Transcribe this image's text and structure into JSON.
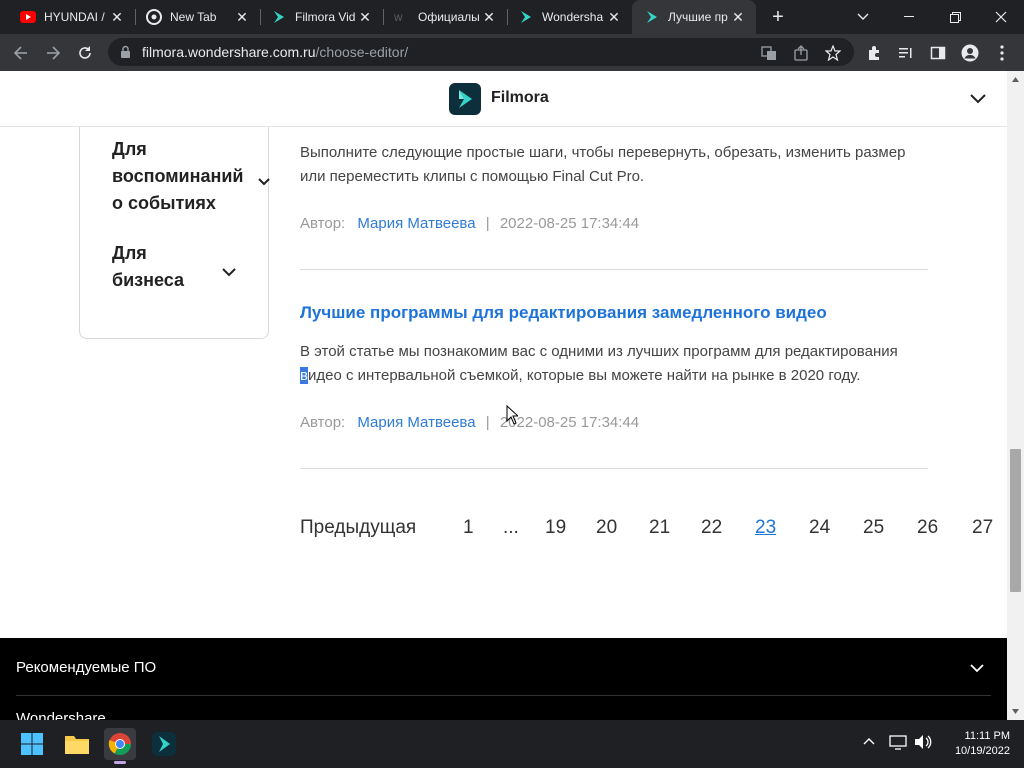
{
  "browser": {
    "tabs": [
      {
        "title": "HYUNDAI /",
        "favicon": "youtube-icon",
        "active": false
      },
      {
        "title": "New Tab",
        "favicon": "chrome-icon",
        "active": false
      },
      {
        "title": "Filmora Vid",
        "favicon": "filmora-icon",
        "active": false
      },
      {
        "title": "Официалы",
        "favicon": "ws-icon",
        "active": false
      },
      {
        "title": "Wondersha",
        "favicon": "filmora-icon",
        "active": false
      },
      {
        "title": "Лучшие пр",
        "favicon": "filmora-icon",
        "active": true
      }
    ],
    "url_host": "filmora.wondershare.com.ru",
    "url_path": "/choose-editor/"
  },
  "site": {
    "brand": "Filmora"
  },
  "sidebar": {
    "items": [
      {
        "label_lines": [
          "Для",
          "воспоминаний",
          "о событиях"
        ]
      },
      {
        "label_lines": [
          "Для",
          "бизнеса"
        ]
      }
    ]
  },
  "articles": [
    {
      "text_line1": "Выполните следующие простые шаги, чтобы перевернуть, обрезать, изменить размер",
      "text_line2": "или переместить клипы с помощью Final Cut Pro.",
      "author_label": "Автор:",
      "author": "Мария Матвеева",
      "separator": "|",
      "date": "2022-08-25 17:34:44"
    },
    {
      "title": "Лучшие программы для редактирования замедленного видео",
      "text_line1": "В этой статье мы познакомим вас с одними из лучших программ для редактирования",
      "text_line2_selected": "в",
      "text_line2_rest": "идео с интервальной съемкой, которые вы можете найти на рынке в 2020 году.",
      "author_label": "Автор:",
      "author": "Мария Матвеева",
      "separator": "|",
      "date": "2022-08-25 17:34:44"
    }
  ],
  "pagination": {
    "prev_label": "Предыдущая",
    "pages": [
      "1",
      "...",
      "19",
      "20",
      "21",
      "22",
      "23",
      "24",
      "25",
      "26",
      "27"
    ],
    "current": "23"
  },
  "footer": {
    "section_title": "Рекомендуемые ПО",
    "next_section_partial": "Wondershare"
  },
  "taskbar": {
    "time": "11:11 PM",
    "date": "10/19/2022"
  },
  "colors": {
    "link": "#1e73d8",
    "author": "#2f7bd5",
    "chrome_dark": "#202124",
    "chrome_toolbar": "#35363a"
  }
}
